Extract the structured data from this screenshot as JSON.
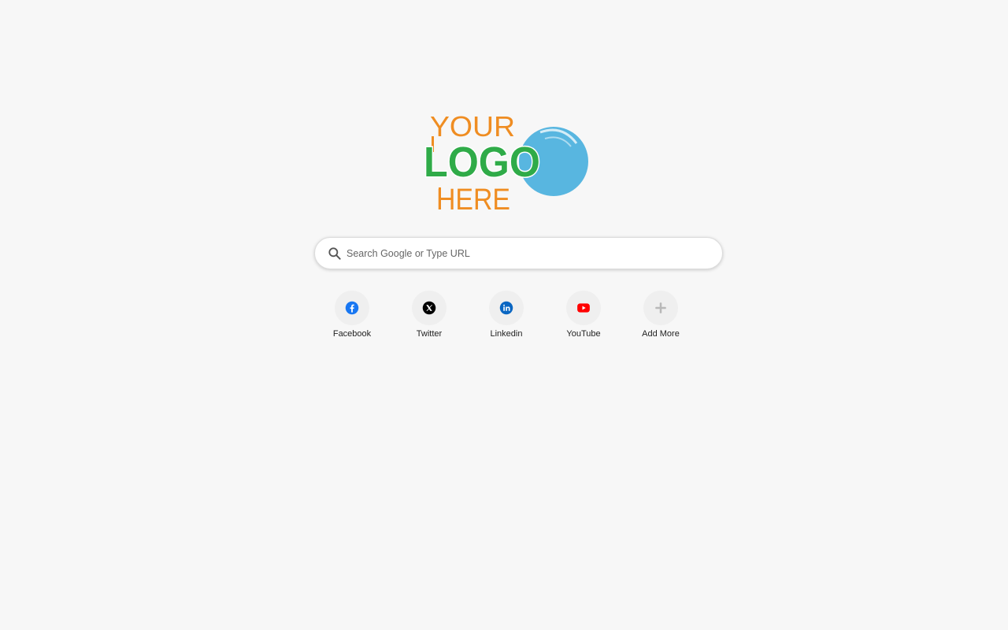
{
  "logo": {
    "line1": "YOUR",
    "line2": "LOGO",
    "line3": "HERE",
    "colors": {
      "orange": "#ef8d22",
      "green": "#2fab48",
      "blue": "#58b6e0"
    }
  },
  "search": {
    "placeholder": "Search Google or Type URL",
    "icon": "search-icon"
  },
  "shortcuts": [
    {
      "label": "Facebook",
      "icon": "facebook-icon",
      "color": "#1877f2"
    },
    {
      "label": "Twitter",
      "icon": "x-icon",
      "color": "#000000"
    },
    {
      "label": "Linkedin",
      "icon": "linkedin-icon",
      "color": "#0a66c2"
    },
    {
      "label": "YouTube",
      "icon": "youtube-icon",
      "color": "#ff0000"
    },
    {
      "label": "Add More",
      "icon": "plus-icon",
      "color": "#b8b8b8"
    }
  ]
}
